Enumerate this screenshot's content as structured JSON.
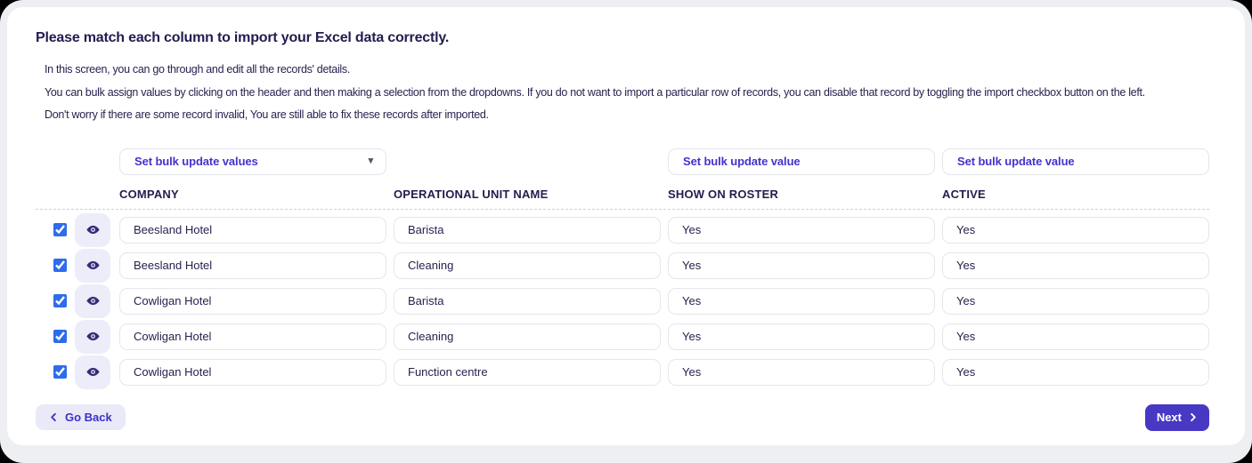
{
  "page": {
    "title": "Please match each column to import your Excel data correctly.",
    "description_lines": [
      "In this screen, you can go through and edit all the records' details.",
      "You can bulk assign values by clicking on the header and then making a selection from the dropdowns. If you do not want to import a particular row of records, you can disable that record by toggling the import checkbox button on the left.",
      "Don't worry if there are some record invalid, You are still able to fix these records after imported."
    ]
  },
  "bulk_controls": {
    "company_dropdown_label": "Set bulk update values",
    "show_on_roster_button_label": "Set bulk update value",
    "active_button_label": "Set bulk update value",
    "dropdown_caret": "▾"
  },
  "table": {
    "headers": {
      "company": "COMPANY",
      "operational_unit": "OPERATIONAL UNIT NAME",
      "show_on_roster": "SHOW ON ROSTER",
      "active": "ACTIVE"
    },
    "rows": [
      {
        "import_checked": true,
        "company": "Beesland Hotel",
        "operational_unit": "Barista",
        "show_on_roster": "Yes",
        "active": "Yes"
      },
      {
        "import_checked": true,
        "company": "Beesland Hotel",
        "operational_unit": "Cleaning",
        "show_on_roster": "Yes",
        "active": "Yes"
      },
      {
        "import_checked": true,
        "company": "Cowligan Hotel",
        "operational_unit": "Barista",
        "show_on_roster": "Yes",
        "active": "Yes"
      },
      {
        "import_checked": true,
        "company": "Cowligan Hotel",
        "operational_unit": "Cleaning",
        "show_on_roster": "Yes",
        "active": "Yes"
      },
      {
        "import_checked": true,
        "company": "Cowligan Hotel",
        "operational_unit": "Function centre",
        "show_on_roster": "Yes",
        "active": "Yes"
      }
    ]
  },
  "footer": {
    "back_label": "Go Back",
    "next_label": "Next"
  },
  "colors": {
    "accent_purple": "#4739c4",
    "accent_purple_text": "#4432cd",
    "checkbox_blue": "#2e6cea",
    "text_dark_navy": "#221d4f",
    "eye_button_bg": "#ecedf8",
    "card_bg": "#ffffff",
    "frame_bg": "#edeff3"
  }
}
